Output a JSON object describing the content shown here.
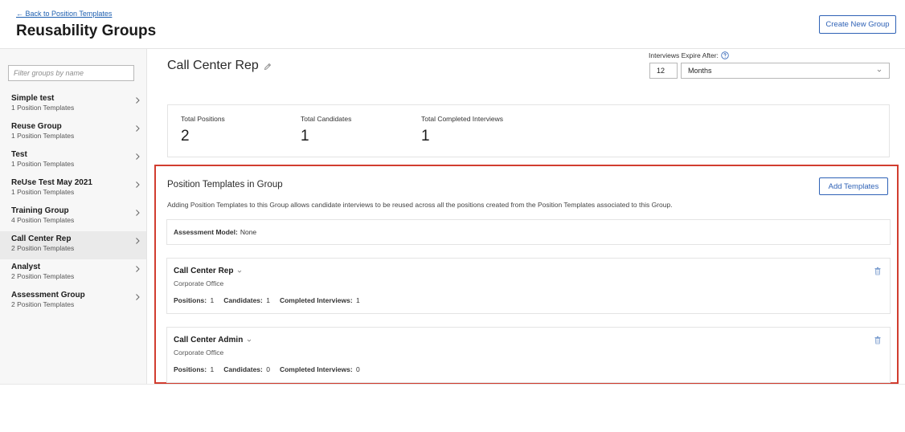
{
  "header": {
    "back_link": "← Back to Position Templates",
    "title": "Reusability Groups",
    "create_button": "Create New Group"
  },
  "sidebar": {
    "filter_placeholder": "Filter groups by name",
    "groups": [
      {
        "name": "Simple test",
        "count": "1 Position Templates"
      },
      {
        "name": "Reuse Group",
        "count": "1 Position Templates"
      },
      {
        "name": "Test",
        "count": "1 Position Templates"
      },
      {
        "name": "ReUse Test May 2021",
        "count": "1 Position Templates"
      },
      {
        "name": "Training Group",
        "count": "4 Position Templates"
      },
      {
        "name": "Call Center Rep",
        "count": "2 Position Templates",
        "active": true
      },
      {
        "name": "Analyst",
        "count": "2 Position Templates"
      },
      {
        "name": "Assessment Group",
        "count": "2 Position Templates"
      }
    ]
  },
  "main": {
    "group_title": "Call Center Rep",
    "expire": {
      "label": "Interviews Expire After:",
      "value": "12",
      "unit": "Months"
    },
    "stats": {
      "total_positions_label": "Total Positions",
      "total_positions": "2",
      "total_candidates_label": "Total Candidates",
      "total_candidates": "1",
      "total_completed_label": "Total Completed Interviews",
      "total_completed": "1"
    },
    "templates_section": {
      "title": "Position Templates in Group",
      "add_button": "Add Templates",
      "description": "Adding Position Templates to this Group allows candidate interviews to be reused across all the positions created from the Position Templates associated to this Group.",
      "assessment_label": "Assessment Model:",
      "assessment_value": "None",
      "templates": [
        {
          "name": "Call Center Rep",
          "location": "Corporate Office",
          "positions_label": "Positions:",
          "positions": "1",
          "candidates_label": "Candidates:",
          "candidates": "1",
          "completed_label": "Completed Interviews:",
          "completed": "1"
        },
        {
          "name": "Call Center Admin",
          "location": "Corporate Office",
          "positions_label": "Positions:",
          "positions": "1",
          "candidates_label": "Candidates:",
          "candidates": "0",
          "completed_label": "Completed Interviews:",
          "completed": "0"
        }
      ]
    }
  },
  "colors": {
    "accent": "#2f62b6",
    "highlight_border": "#d13d2f"
  }
}
